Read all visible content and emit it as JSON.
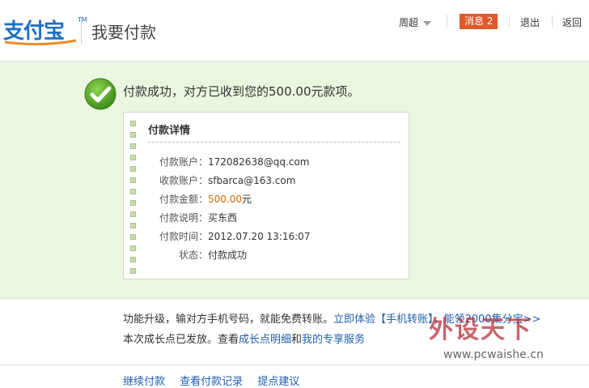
{
  "header": {
    "logo_text": "支付宝",
    "logo_tm": "TM",
    "page_title": "我要付款",
    "user": "周超",
    "messages_label": "消息",
    "messages_count": "2",
    "logout": "退出",
    "back": "返回"
  },
  "result": {
    "message": "付款成功，对方已收到您的500.00元款项。"
  },
  "details": {
    "title": "付款详情",
    "rows": [
      {
        "key": "付款账户：",
        "value": "172082638@qq.com"
      },
      {
        "key": "收款账户：",
        "value": "sfbarca@163.com"
      },
      {
        "key": "付款金额：",
        "value": "500.00",
        "unit": "元"
      },
      {
        "key": "付款说明：",
        "value": "买东西"
      },
      {
        "key": "付款时间：",
        "value": "2012.07.20 13:16:07"
      },
      {
        "key": "状态：",
        "value": "付款成功"
      }
    ]
  },
  "promo": {
    "line1_text": "功能升级，输对方手机号码，就能免费转账。",
    "line1_link": "立即体验【手机转账】，能领2000集分宝>>",
    "line2_prefix": "本次成长点已发放。查看",
    "line2_link1": "成长点明细",
    "line2_mid": "和",
    "line2_link2": "我的专享服务"
  },
  "bottom_links": [
    "继续付款",
    "查看付款记录",
    "提点建议"
  ],
  "watermark": {
    "text": "外设天下",
    "url": "www.pcwaishe.cn"
  },
  "colors": {
    "success_bg": "#eaf6e0",
    "amount": "#e06a00",
    "link": "#1f5fb0",
    "badge": "#e05a2b"
  }
}
